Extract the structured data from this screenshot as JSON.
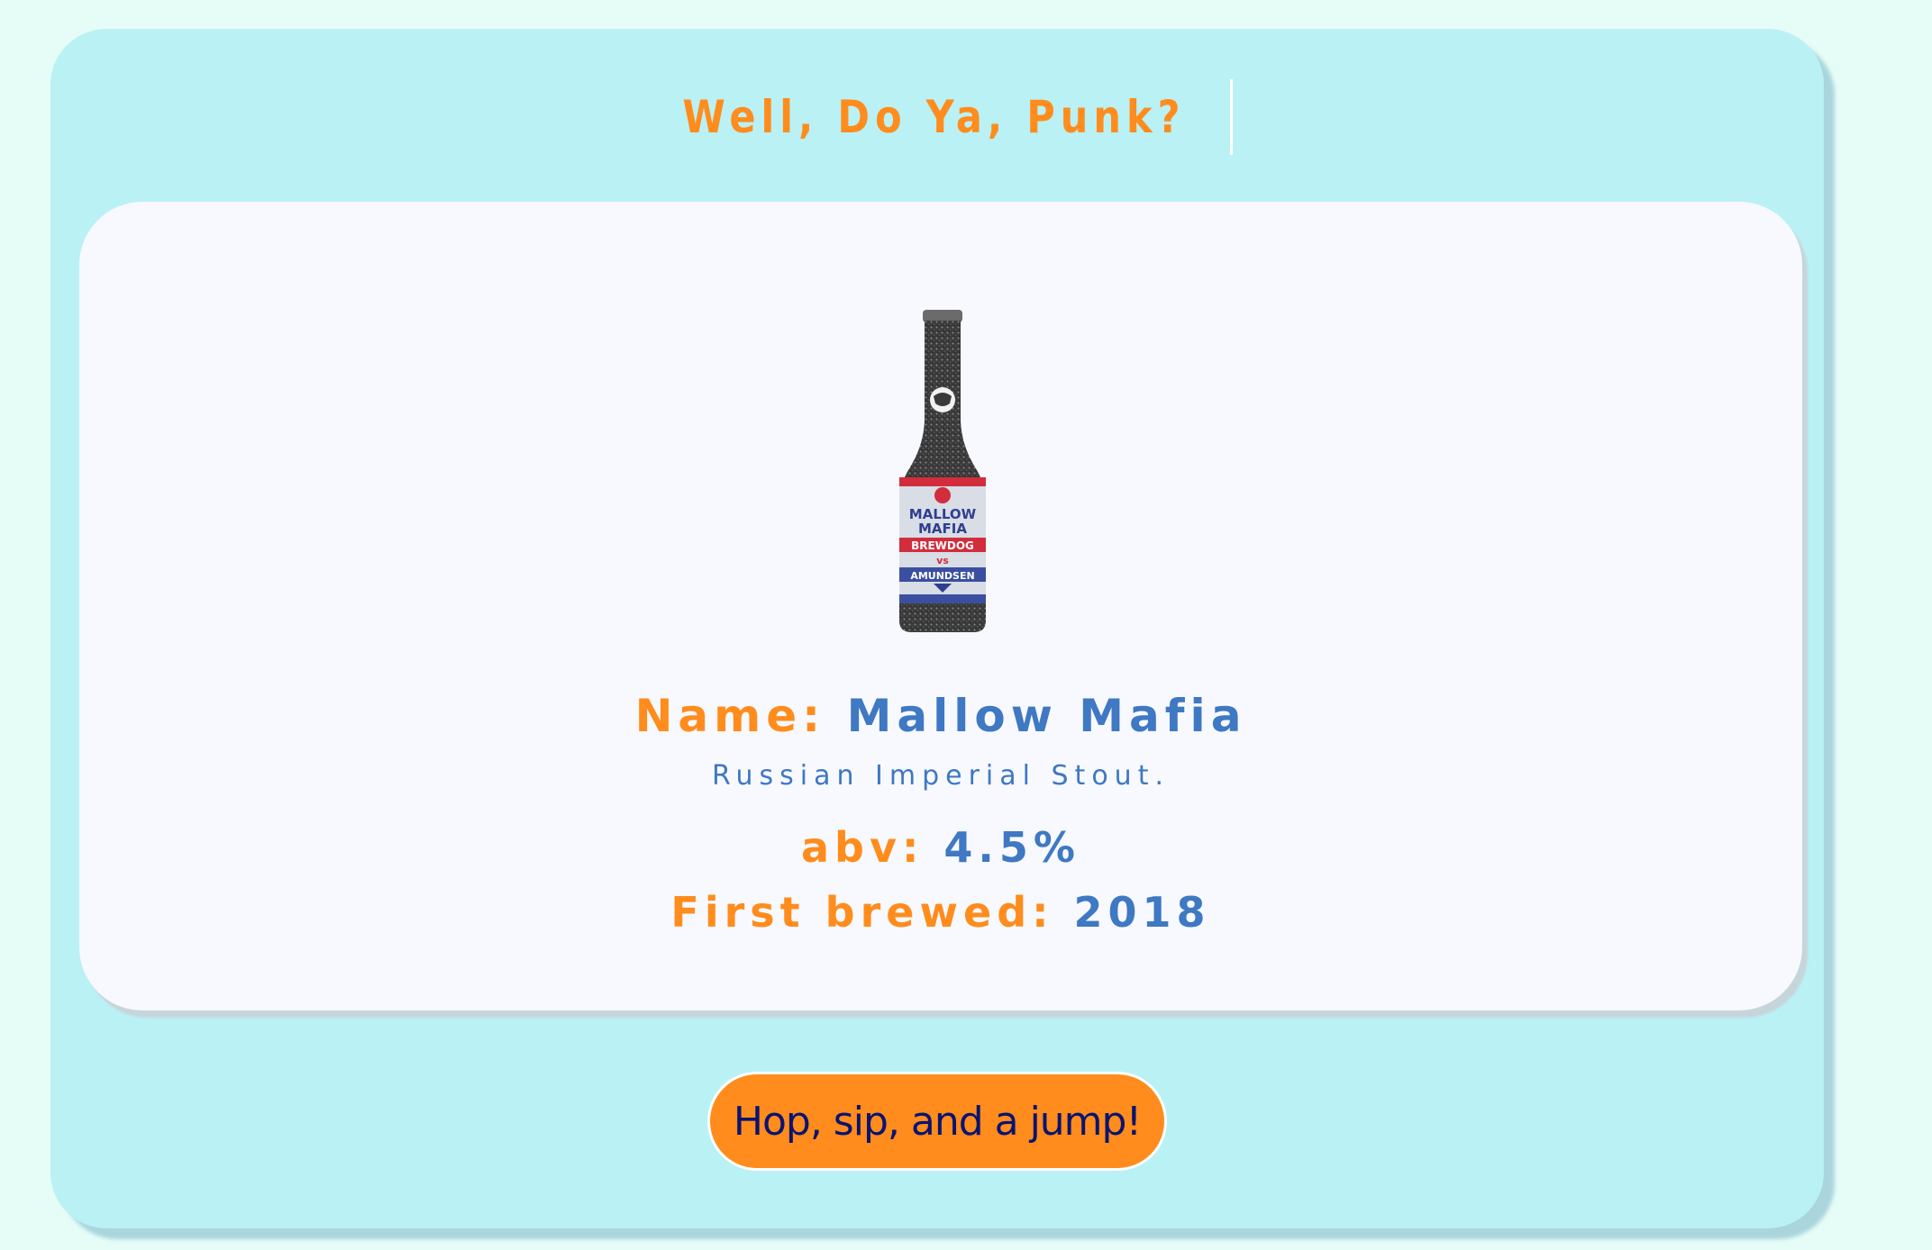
{
  "header": {
    "title": "Well, Do Ya, Punk?"
  },
  "beer": {
    "name_label": "Name:",
    "name": "Mallow Mafia",
    "tagline": "Russian Imperial Stout.",
    "abv_label": "abv:",
    "abv": "4.5%",
    "first_brewed_label": "First brewed:",
    "first_brewed": "2018",
    "bottle_label": {
      "line1": "MALLOW",
      "line2": "MAFIA",
      "line3": "BREWDOG",
      "line4": "vs",
      "line5": "AMUNDSEN"
    }
  },
  "actions": {
    "next_label": "Hop, sip, and a jump!"
  },
  "colors": {
    "page_bg": "#e6fdf7",
    "outer_card": "#baf1f4",
    "inner_card": "#f7f9fe",
    "accent_orange": "#ff8c1c",
    "value_blue": "#3f78c3",
    "button_text": "#0a1470"
  }
}
